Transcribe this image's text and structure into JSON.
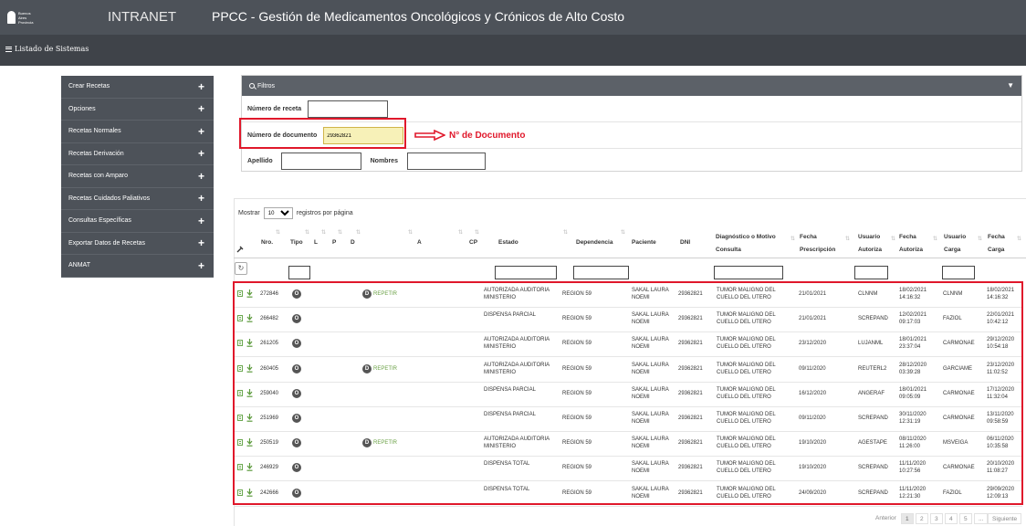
{
  "header": {
    "logo_text": [
      "Buenos",
      "Aires",
      "Provincia"
    ],
    "intranet": "INTRANET",
    "title": "PPCC - Gestión de Medicamentos Oncológicos y Crónicos de Alto Costo"
  },
  "subbar": {
    "label": "Listado de Sistemas"
  },
  "sidebar": {
    "items": [
      {
        "label": "Crear Recetas"
      },
      {
        "label": "Opciones"
      },
      {
        "label": "Recetas Normales"
      },
      {
        "label": "Recetas Derivación"
      },
      {
        "label": "Recetas con Amparo"
      },
      {
        "label": "Recetas Cuidados Paliativos"
      },
      {
        "label": "Consultas Específicas"
      },
      {
        "label": "Exportar Datos de Recetas"
      },
      {
        "label": "ANMAT"
      }
    ]
  },
  "filters": {
    "title": "Filtros",
    "receta_label": "Número de receta",
    "receta_value": "",
    "documento_label": "Número de documento",
    "documento_value": "29362821",
    "apellido_label": "Apellido",
    "apellido_value": "",
    "nombres_label": "Nombres",
    "nombres_value": "",
    "annotation": "N° de Documento"
  },
  "table": {
    "show_prefix": "Mostrar",
    "show_value": "10",
    "show_suffix": "registros por página",
    "headers": {
      "nro": "Nro.",
      "tipo": "Tipo",
      "l": "L",
      "p": "P",
      "d": "D",
      "a": "A",
      "cp": "CP",
      "estado": "Estado",
      "dependencia": "Dependencia",
      "paciente": "Paciente",
      "dni": "DNI",
      "diagnostico_1": "Diagnóstico o Motivo",
      "diagnostico_2": "Consulta",
      "fecha_presc_1": "Fecha",
      "fecha_presc_2": "Prescripción",
      "usuario_aut_1": "Usuario",
      "usuario_aut_2": "Autoriza",
      "fecha_aut_1": "Fecha",
      "fecha_aut_2": "Autoriza",
      "usuario_carga_1": "Usuario",
      "usuario_carga_2": "Carga",
      "fecha_carga_1": "Fecha",
      "fecha_carga_2": "Carga"
    },
    "rows": [
      {
        "nro": "272846",
        "tipo": "O",
        "d": "D",
        "repetir": "REPETIR",
        "estado1": "AUTORIZADA AUDITORIA",
        "estado2": "MINISTERIO",
        "dep": "REGION 59",
        "pac1": "SAKAL LAURA",
        "pac2": "NOEMI",
        "dni": "29362821",
        "diag1": "TUMOR MALIGNO DEL",
        "diag2": "CUELLO DEL UTERO",
        "fpresc": "21/01/2021",
        "uaut": "CLNNM",
        "faut1": "18/02/2021",
        "faut2": "14:16:32",
        "ucarga": "CLNNM",
        "fcarga1": "18/02/2021",
        "fcarga2": "14:16:32"
      },
      {
        "nro": "266482",
        "tipo": "O",
        "d": "",
        "repetir": "",
        "estado1": "DISPENSA PARCIAL",
        "estado2": "",
        "dep": "REGION 59",
        "pac1": "SAKAL LAURA",
        "pac2": "NOEMI",
        "dni": "29362821",
        "diag1": "TUMOR MALIGNO DEL",
        "diag2": "CUELLO DEL UTERO",
        "fpresc": "21/01/2021",
        "uaut": "SCREPAND",
        "faut1": "12/02/2021",
        "faut2": "09:17:03",
        "ucarga": "FAZIOL",
        "fcarga1": "22/01/2021",
        "fcarga2": "10:42:12"
      },
      {
        "nro": "261205",
        "tipo": "O",
        "d": "",
        "repetir": "",
        "estado1": "AUTORIZADA AUDITORIA",
        "estado2": "MINISTERIO",
        "dep": "REGION 59",
        "pac1": "SAKAL LAURA",
        "pac2": "NOEMI",
        "dni": "29362821",
        "diag1": "TUMOR MALIGNO DEL",
        "diag2": "CUELLO DEL UTERO",
        "fpresc": "23/12/2020",
        "uaut": "LUJANML",
        "faut1": "18/01/2021",
        "faut2": "23:37:04",
        "ucarga": "CARMONAE",
        "fcarga1": "29/12/2020",
        "fcarga2": "10:54:18"
      },
      {
        "nro": "260405",
        "tipo": "O",
        "d": "D",
        "repetir": "REPETIR",
        "estado1": "AUTORIZADA AUDITORIA",
        "estado2": "MINISTERIO",
        "dep": "REGION 59",
        "pac1": "SAKAL LAURA",
        "pac2": "NOEMI",
        "dni": "29362821",
        "diag1": "TUMOR MALIGNO DEL",
        "diag2": "CUELLO DEL UTERO",
        "fpresc": "09/11/2020",
        "uaut": "REUTERL2",
        "faut1": "28/12/2020",
        "faut2": "03:39:28",
        "ucarga": "GARCIAME",
        "fcarga1": "23/12/2020",
        "fcarga2": "11:02:52"
      },
      {
        "nro": "259040",
        "tipo": "O",
        "d": "",
        "repetir": "",
        "estado1": "DISPENSA PARCIAL",
        "estado2": "",
        "dep": "REGION 59",
        "pac1": "SAKAL LAURA",
        "pac2": "NOEMI",
        "dni": "29362821",
        "diag1": "TUMOR MALIGNO DEL",
        "diag2": "CUELLO DEL UTERO",
        "fpresc": "16/12/2020",
        "uaut": "ANGERAF",
        "faut1": "18/01/2021",
        "faut2": "09:05:09",
        "ucarga": "CARMONAE",
        "fcarga1": "17/12/2020",
        "fcarga2": "11:32:04"
      },
      {
        "nro": "251969",
        "tipo": "O",
        "d": "",
        "repetir": "",
        "estado1": "DISPENSA PARCIAL",
        "estado2": "",
        "dep": "REGION 59",
        "pac1": "SAKAL LAURA",
        "pac2": "NOEMI",
        "dni": "29362821",
        "diag1": "TUMOR MALIGNO DEL",
        "diag2": "CUELLO DEL UTERO",
        "fpresc": "09/11/2020",
        "uaut": "SCREPAND",
        "faut1": "30/11/2020",
        "faut2": "12:31:19",
        "ucarga": "CARMONAE",
        "fcarga1": "13/11/2020",
        "fcarga2": "09:58:59"
      },
      {
        "nro": "250519",
        "tipo": "O",
        "d": "D",
        "repetir": "REPETIR",
        "estado1": "AUTORIZADA AUDITORIA",
        "estado2": "MINISTERIO",
        "dep": "REGION 59",
        "pac1": "SAKAL LAURA",
        "pac2": "NOEMI",
        "dni": "29362821",
        "diag1": "TUMOR MALIGNO DEL",
        "diag2": "CUELLO DEL UTERO",
        "fpresc": "19/10/2020",
        "uaut": "AGESTAPE",
        "faut1": "08/11/2020",
        "faut2": "11:26:00",
        "ucarga": "MSVEIGA",
        "fcarga1": "06/11/2020",
        "fcarga2": "10:35:58"
      },
      {
        "nro": "246929",
        "tipo": "O",
        "d": "",
        "repetir": "",
        "estado1": "DISPENSA TOTAL",
        "estado2": "",
        "dep": "REGION 59",
        "pac1": "SAKAL LAURA",
        "pac2": "NOEMI",
        "dni": "29362821",
        "diag1": "TUMOR MALIGNO DEL",
        "diag2": "CUELLO DEL UTERO",
        "fpresc": "19/10/2020",
        "uaut": "SCREPAND",
        "faut1": "11/11/2020",
        "faut2": "10:27:56",
        "ucarga": "CARMONAE",
        "fcarga1": "20/10/2020",
        "fcarga2": "11:08:27"
      },
      {
        "nro": "242666",
        "tipo": "O",
        "d": "",
        "repetir": "",
        "estado1": "DISPENSA TOTAL",
        "estado2": "",
        "dep": "REGION 59",
        "pac1": "SAKAL LAURA",
        "pac2": "NOEMI",
        "dni": "29362821",
        "diag1": "TUMOR MALIGNO DEL",
        "diag2": "CUELLO DEL UTERO",
        "fpresc": "24/09/2020",
        "uaut": "SCREPAND",
        "faut1": "11/11/2020",
        "faut2": "12:21:30",
        "ucarga": "FAZIOL",
        "fcarga1": "29/09/2020",
        "fcarga2": "12:09:13"
      }
    ]
  },
  "pagination": {
    "prev": "Anterior",
    "pages": [
      "1",
      "2",
      "3",
      "4",
      "5"
    ],
    "ellipsis": "...",
    "next": "Siguiente"
  },
  "colors": {
    "dark_bar": "#4d5259",
    "highlight": "#e0182b",
    "repetir": "#6ba146"
  }
}
